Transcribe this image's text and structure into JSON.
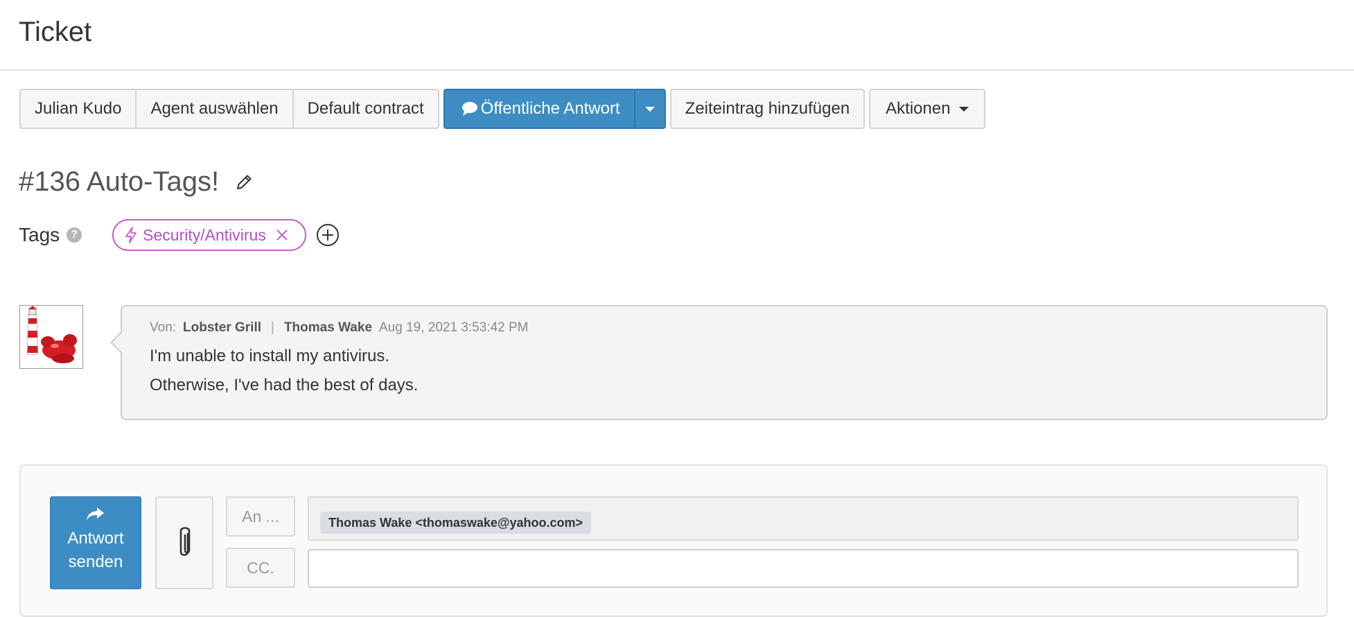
{
  "header": {
    "title": "Ticket"
  },
  "toolbar": {
    "customer": "Julian Kudo",
    "agent": "Agent auswählen",
    "contract": "Default contract",
    "reply": "Öffentliche Antwort",
    "time_entry": "Zeiteintrag hinzufügen",
    "actions": "Aktionen"
  },
  "ticket": {
    "title": "#136 Auto-Tags!",
    "tags_label": "Tags",
    "help_glyph": "?",
    "tags": [
      {
        "label": "Security/Antivirus",
        "color": "#c45ed0"
      }
    ]
  },
  "message": {
    "from_label": "Von:",
    "company": "Lobster Grill",
    "separator": "|",
    "sender": "Thomas Wake",
    "timestamp": "Aug 19, 2021 3:53:42 PM",
    "lines": [
      "I'm unable to install my antivirus.",
      "Otherwise, I've had the best of days."
    ]
  },
  "reply": {
    "send_line1": "Antwort",
    "send_line2": "senden",
    "to_label": "An ...",
    "cc_label": "CC.",
    "recipient": "Thomas Wake <thomaswake@yahoo.com>",
    "cc_value": ""
  },
  "colors": {
    "primary": "#3d8cc4",
    "tag": "#c45ed0",
    "message_bg": "#f4f4f4"
  }
}
